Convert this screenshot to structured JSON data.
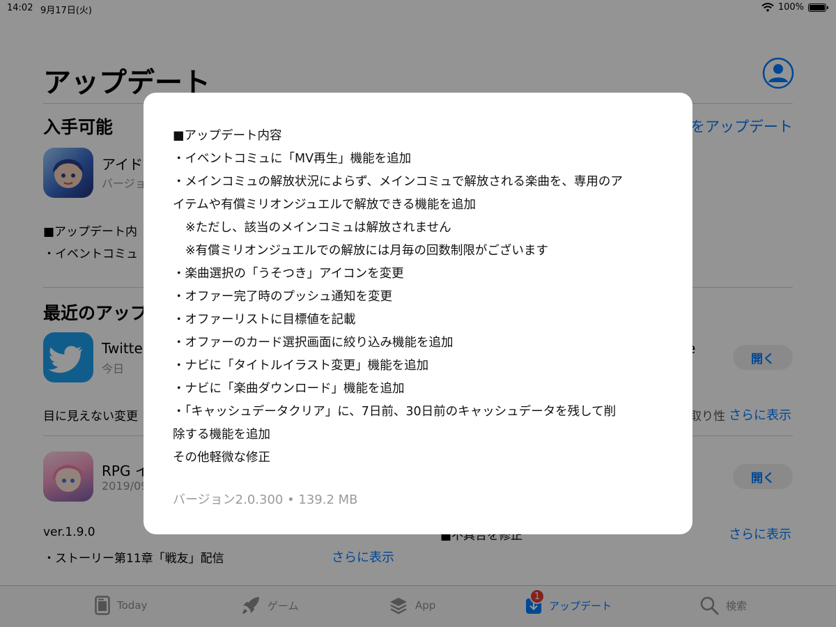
{
  "status_bar": {
    "time": "14:02",
    "date": "9月17日(火)",
    "battery": "100%"
  },
  "page": {
    "title": "アップデート"
  },
  "available": {
    "section_title": "入手可能",
    "update_all_label": "をアップデート",
    "app": {
      "name": "アイド",
      "subtitle": "バージョ",
      "notes_line1": "■アップデート内",
      "notes_line2": "・イベントコミュ"
    }
  },
  "recent": {
    "section_title": "最近のアップ",
    "apps": [
      {
        "name": "Twitte",
        "subtitle": "今日",
        "right_name": "e",
        "open_label": "開く",
        "notes": "目に見えない変更",
        "notes_right": "取り性",
        "more_label": "さらに表示"
      },
      {
        "name": "RPG イ",
        "subtitle": "2019/09",
        "open_label": "開く",
        "notes_line1": "ver.1.9.0",
        "notes_line2": "・ストーリー第11章「戦友」配信",
        "notes_more_label": "さらに表示",
        "notes_right": "■不具合を修正",
        "more_label": "さらに表示"
      }
    ]
  },
  "modal": {
    "lines": [
      "■アップデート内容",
      "・イベントコミュに「MV再生」機能を追加",
      "・メインコミュの解放状況によらず、メインコミュで解放される楽曲を、専用のア",
      "イテムや有償ミリオンジュエルで解放できる機能を追加",
      "※ただし、該当のメインコミュは解放されません",
      "※有償ミリオンジュエルでの解放には月毎の回数制限がございます",
      "・楽曲選択の「うそつき」アイコンを変更",
      "・オファー完了時のプッシュ通知を変更",
      "・オファーリストに目標値を記載",
      "・オファーのカード選択画面に絞り込み機能を追加",
      "・ナビに「タイトルイラスト変更」機能を追加",
      "・ナビに「楽曲ダウンロード」機能を追加",
      "・「キャッシュデータクリア」に、7日前、30日前のキャッシュデータを残して削",
      "除する機能を追加",
      "その他軽微な修正"
    ],
    "footer": "バージョン2.0.300 • 139.2 MB"
  },
  "tab_bar": {
    "tabs": [
      {
        "label": "Today",
        "icon": "today-icon"
      },
      {
        "label": "ゲーム",
        "icon": "rocket-icon"
      },
      {
        "label": "App",
        "icon": "layers-icon"
      },
      {
        "label": "アップデート",
        "icon": "download-icon",
        "badge": "1",
        "active": true
      },
      {
        "label": "検索",
        "icon": "search-icon"
      }
    ]
  },
  "colors": {
    "accent": "#007aff",
    "badge": "#e53935",
    "overlay": "rgba(0,0,0,0.42)"
  }
}
